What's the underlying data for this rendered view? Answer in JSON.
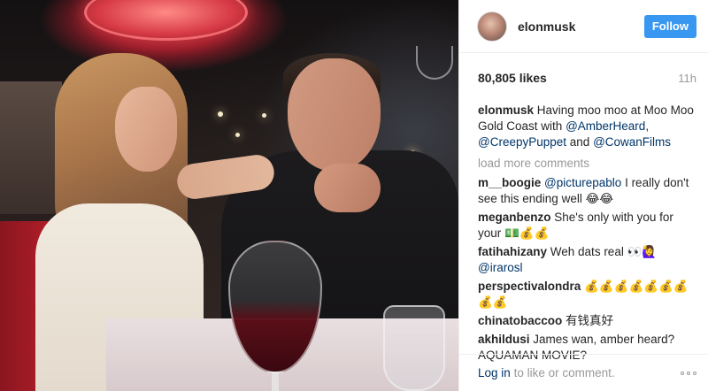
{
  "post": {
    "username": "elonmusk",
    "follow_label": "Follow",
    "likes": "80,805 likes",
    "time": "11h",
    "caption": {
      "user": "elonmusk",
      "text": "Having moo moo at Moo Moo Gold Coast with",
      "mention1": "@AmberHeard",
      "sep": ",",
      "mention2": "@CreepyPuppet",
      "and": "and",
      "mention3": "@CowanFilms"
    },
    "load_more": "load more comments",
    "comments": [
      {
        "user": "m__boogie",
        "mention": "@picturepablo",
        "text": "I really don't see this ending well 😂😂"
      },
      {
        "user": "meganbenzo",
        "text": "She's only with you for your 💵💰💰"
      },
      {
        "user": "fatihahizany",
        "text": "Weh dats real 👀🙋‍♀️",
        "mention": "@irarosl"
      },
      {
        "user": "perspectivalondra",
        "text": "💰💰💰💰💰💰💰💰💰"
      },
      {
        "user": "chinatobaccoo",
        "text": "有钱真好"
      },
      {
        "user": "akhildusi",
        "text": "James wan, amber heard? AQUAMAN MOVIE?"
      }
    ],
    "footer": {
      "login_label": "Log in",
      "rest": "to like or comment."
    },
    "icons": {
      "avatar": "profile-avatar",
      "more": "more-options-icon"
    },
    "colors": {
      "follow_bg": "#3897f0",
      "link": "#003569",
      "muted": "#999999"
    }
  }
}
